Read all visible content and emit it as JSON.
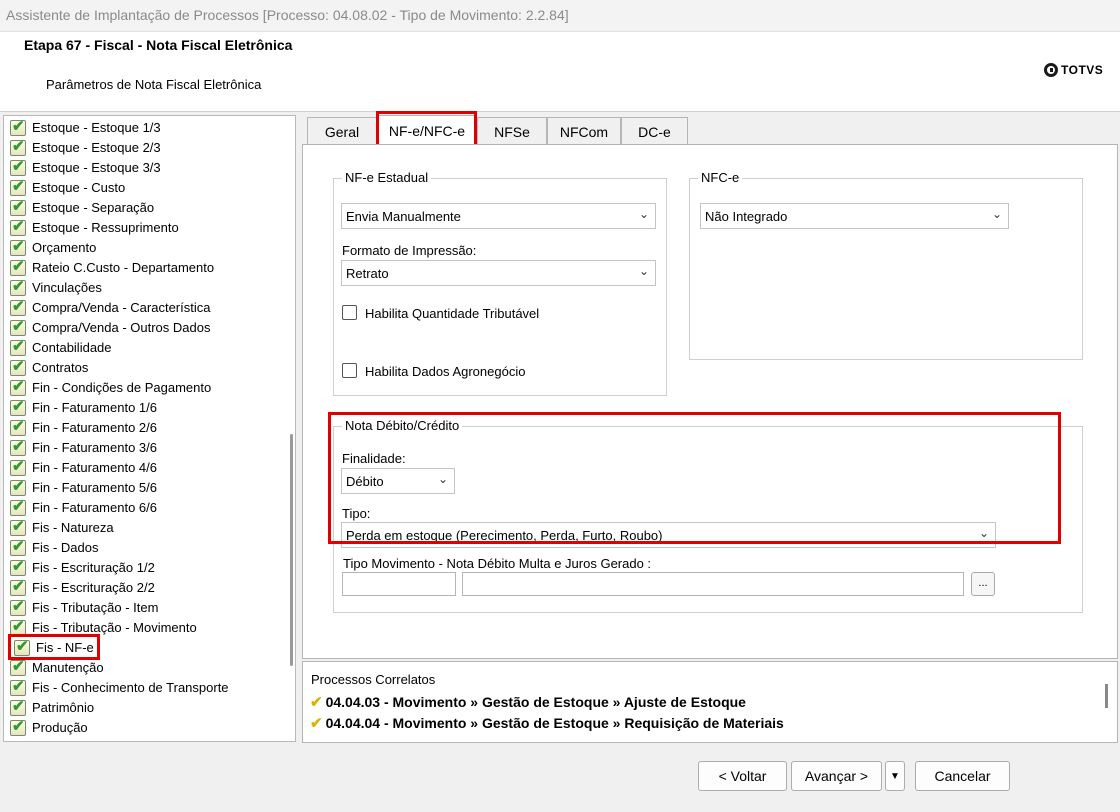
{
  "window": {
    "title": "Assistente de Implantação de Processos [Processo: 04.08.02 - Tipo de Movimento: 2.2.84]"
  },
  "header": {
    "step_title": "Etapa 67 - Fiscal - Nota Fiscal Eletrônica",
    "subtitle": "Parâmetros de Nota Fiscal Eletrônica",
    "logo_text": "TOTVS"
  },
  "tree": {
    "items": [
      "Estoque - Estoque 1/3",
      "Estoque - Estoque 2/3",
      "Estoque - Estoque 3/3",
      "Estoque - Custo",
      "Estoque - Separação",
      "Estoque - Ressuprimento",
      "Orçamento",
      "Rateio C.Custo - Departamento",
      "Vinculações",
      "Compra/Venda - Característica",
      "Compra/Venda - Outros Dados",
      "Contabilidade",
      "Contratos",
      "Fin - Condições de Pagamento",
      "Fin - Faturamento 1/6",
      "Fin - Faturamento 2/6",
      "Fin - Faturamento 3/6",
      "Fin - Faturamento 4/6",
      "Fin - Faturamento 5/6",
      "Fin - Faturamento 6/6",
      "Fis - Natureza",
      "Fis - Dados",
      "Fis - Escrituração 1/2",
      "Fis - Escrituração 2/2",
      "Fis - Tributação - Item",
      "Fis - Tributação - Movimento",
      "Fis - NF-e",
      "Manutenção",
      "Fis - Conhecimento de Transporte",
      "Patrimônio",
      "Produção"
    ],
    "selected": "Fis - NF-e"
  },
  "tabs": {
    "geral": "Geral",
    "nfe_nfce": "NF-e/NFC-e",
    "nfse": "NFSe",
    "nfcom": "NFCom",
    "dce": "DC-e",
    "active": "NF-e/NFC-e"
  },
  "nfe_estadual": {
    "legend": "NF-e Estadual",
    "envio_value": "Envia Manualmente",
    "formato_label": "Formato de Impressão:",
    "formato_value": "Retrato",
    "qtd_tributavel_label": "Habilita Quantidade Tributável",
    "qtd_tributavel_checked": false,
    "agronegocio_label": "Habilita Dados Agronegócio",
    "agronegocio_checked": false
  },
  "nfce": {
    "legend": "NFC-e",
    "value": "Não Integrado"
  },
  "nota_debito": {
    "legend": "Nota Débito/Crédito",
    "finalidade_label": "Finalidade:",
    "finalidade_value": "Débito",
    "tipo_label": "Tipo:",
    "tipo_value": "Perda em estoque (Perecimento, Perda, Furto, Roubo)",
    "tipo_mov_label": "Tipo Movimento - Nota Débito Multa e Juros Gerado :",
    "tipo_mov_code": "",
    "tipo_mov_desc": "",
    "browse_label": "..."
  },
  "related": {
    "title": "Processos Correlatos",
    "items": [
      "04.04.03 - Movimento » Gestão de Estoque » Ajuste de Estoque",
      "04.04.04 - Movimento » Gestão de Estoque » Requisição de Materiais"
    ]
  },
  "footer": {
    "back": "< Voltar",
    "next": "Avançar >",
    "next_menu": "▼",
    "cancel": "Cancelar"
  },
  "colors": {
    "highlight": "#e00000",
    "check_green": "#2f9a2f"
  }
}
